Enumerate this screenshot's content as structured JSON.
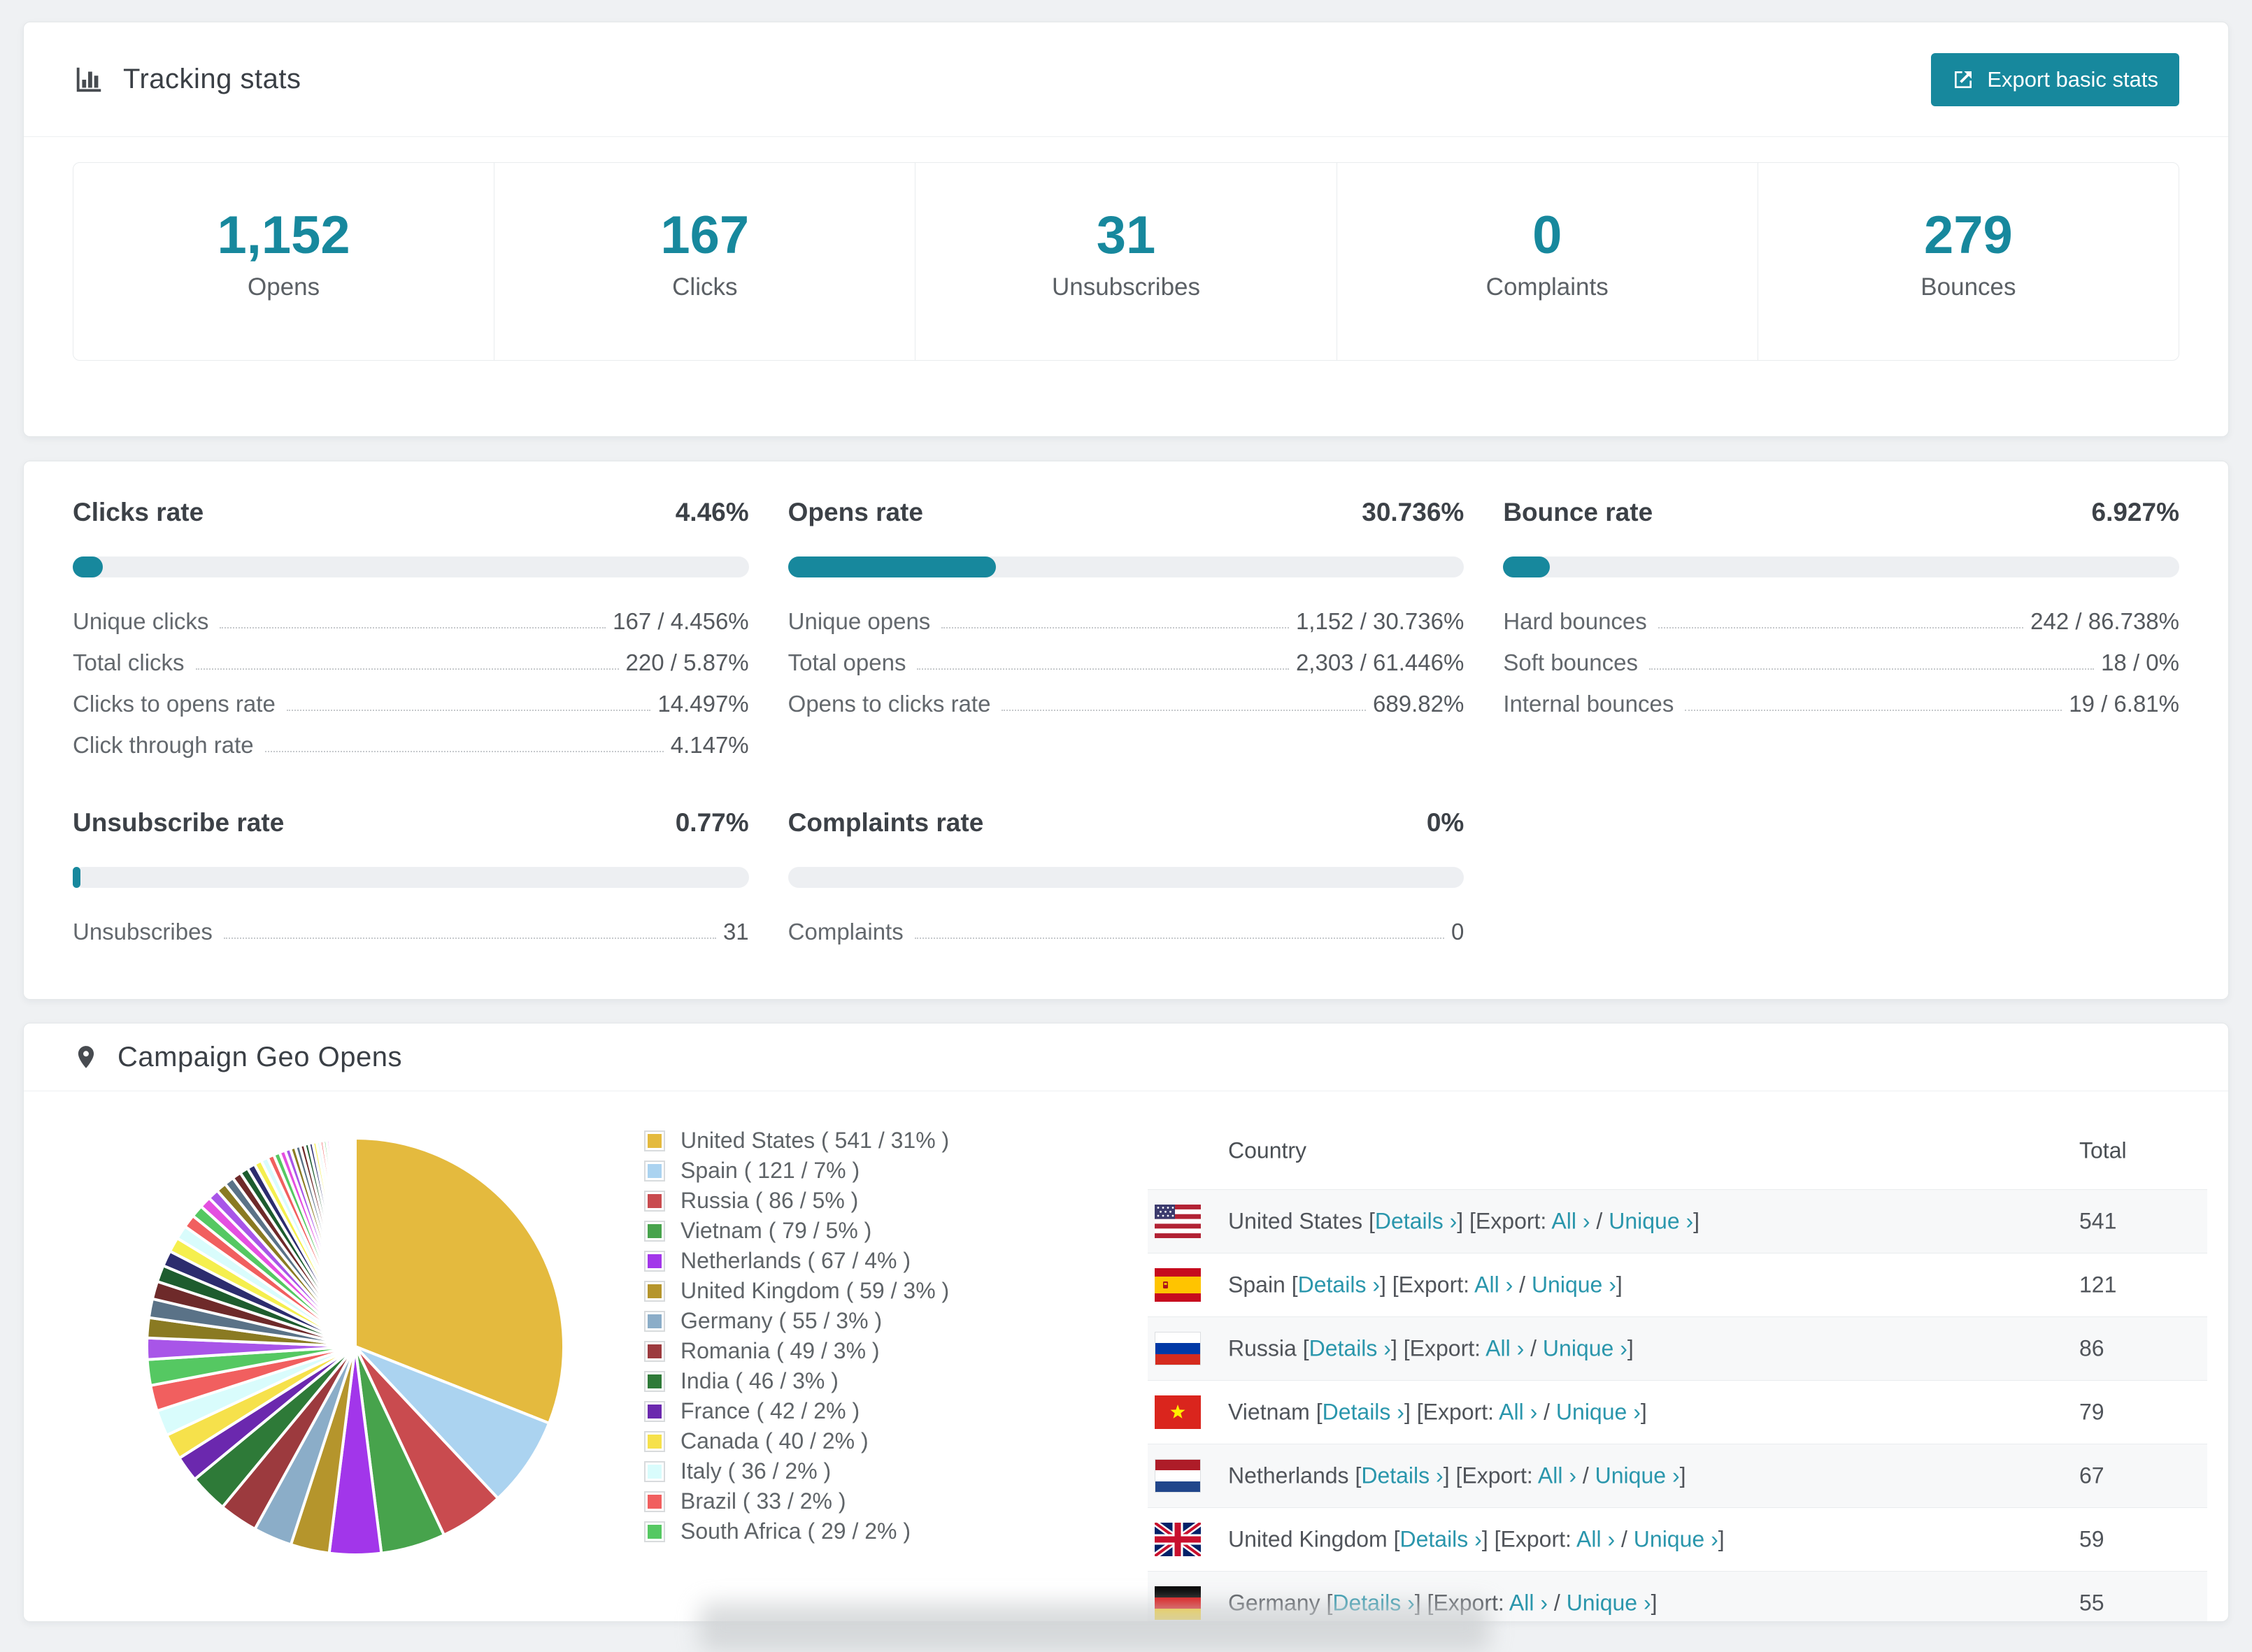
{
  "page": {
    "background": "#eff1f3",
    "accent": "#17889d",
    "link_color": "#2a96ac"
  },
  "tracking": {
    "title": "Tracking stats",
    "export_label": "Export basic stats",
    "summary": [
      {
        "key": "opens",
        "value": "1,152",
        "label": "Opens"
      },
      {
        "key": "clicks",
        "value": "167",
        "label": "Clicks"
      },
      {
        "key": "unsubscribes",
        "value": "31",
        "label": "Unsubscribes"
      },
      {
        "key": "complaints",
        "value": "0",
        "label": "Complaints"
      },
      {
        "key": "bounces",
        "value": "279",
        "label": "Bounces"
      }
    ]
  },
  "rates": [
    {
      "key": "clicks",
      "title": "Clicks rate",
      "percent_label": "4.46%",
      "fill_percent": 4.46,
      "rows": [
        {
          "label": "Unique clicks",
          "value": "167 / 4.456%"
        },
        {
          "label": "Total clicks",
          "value": "220 / 5.87%"
        },
        {
          "label": "Clicks to opens rate",
          "value": "14.497%"
        },
        {
          "label": "Click through rate",
          "value": "4.147%"
        }
      ]
    },
    {
      "key": "opens",
      "title": "Opens rate",
      "percent_label": "30.736%",
      "fill_percent": 30.736,
      "rows": [
        {
          "label": "Unique opens",
          "value": "1,152 / 30.736%"
        },
        {
          "label": "Total opens",
          "value": "2,303 / 61.446%"
        },
        {
          "label": "Opens to clicks rate",
          "value": "689.82%"
        }
      ]
    },
    {
      "key": "bounce",
      "title": "Bounce rate",
      "percent_label": "6.927%",
      "fill_percent": 6.927,
      "rows": [
        {
          "label": "Hard bounces",
          "value": "242 / 86.738%"
        },
        {
          "label": "Soft bounces",
          "value": "18 / 0%"
        },
        {
          "label": "Internal bounces",
          "value": "19 / 6.81%"
        }
      ]
    },
    {
      "key": "unsubscribe",
      "title": "Unsubscribe rate",
      "percent_label": "0.77%",
      "fill_percent": 0.77,
      "rows": [
        {
          "label": "Unsubscribes",
          "value": "31"
        }
      ]
    },
    {
      "key": "complaints",
      "title": "Complaints rate",
      "percent_label": "0%",
      "fill_percent": 0,
      "rows": [
        {
          "label": "Complaints",
          "value": "0"
        }
      ]
    }
  ],
  "geo": {
    "title": "Campaign Geo Opens",
    "chart_data": {
      "type": "pie",
      "title": "Campaign Geo Opens",
      "unit": "opens",
      "legend_position": "right",
      "start_angle_deg": 0,
      "direction": "clockwise",
      "slices": [
        {
          "label": "United States",
          "value": 541,
          "percent": 31,
          "color": "#e4ba3e"
        },
        {
          "label": "Spain",
          "value": 121,
          "percent": 7,
          "color": "#abd3f0"
        },
        {
          "label": "Russia",
          "value": 86,
          "percent": 5,
          "color": "#c94b4f"
        },
        {
          "label": "Vietnam",
          "value": 79,
          "percent": 5,
          "color": "#47a34c"
        },
        {
          "label": "Netherlands",
          "value": 67,
          "percent": 4,
          "color": "#a236ea"
        },
        {
          "label": "United Kingdom",
          "value": 59,
          "percent": 3,
          "color": "#b5952c"
        },
        {
          "label": "Germany",
          "value": 55,
          "percent": 3,
          "color": "#8badc8"
        },
        {
          "label": "Romania",
          "value": 49,
          "percent": 3,
          "color": "#9c3a3e"
        },
        {
          "label": "India",
          "value": 46,
          "percent": 3,
          "color": "#2e7a38"
        },
        {
          "label": "France",
          "value": 42,
          "percent": 2,
          "color": "#6b28ae"
        },
        {
          "label": "Canada",
          "value": 40,
          "percent": 2,
          "color": "#f6e14b"
        },
        {
          "label": "Italy",
          "value": 36,
          "percent": 2,
          "color": "#d9fcfc"
        },
        {
          "label": "Brazil",
          "value": 33,
          "percent": 2,
          "color": "#f15f5f"
        },
        {
          "label": "South Africa",
          "value": 29,
          "percent": 2,
          "color": "#55c862"
        }
      ],
      "other_slices_percent": 26,
      "other_slices_palette": [
        "#a855e8",
        "#8a7a22",
        "#5a7287",
        "#6e2a2a",
        "#1d5c2e",
        "#2c2c6e",
        "#f5ef4e",
        "#d9fcfc",
        "#f15f5f",
        "#55c862",
        "#e44fe0"
      ]
    },
    "table": {
      "headers": [
        "Country",
        "Total"
      ],
      "link_labels": {
        "details": "Details ›",
        "export_prefix": "Export:",
        "all": "All ›",
        "unique": "Unique ›"
      },
      "rows": [
        {
          "flag": "us",
          "country": "United States",
          "total": "541"
        },
        {
          "flag": "es",
          "country": "Spain",
          "total": "121"
        },
        {
          "flag": "ru",
          "country": "Russia",
          "total": "86"
        },
        {
          "flag": "vn",
          "country": "Vietnam",
          "total": "79"
        },
        {
          "flag": "nl",
          "country": "Netherlands",
          "total": "67"
        },
        {
          "flag": "gb",
          "country": "United Kingdom",
          "total": "59"
        },
        {
          "flag": "de",
          "country": "Germany",
          "total": "55"
        }
      ]
    }
  }
}
